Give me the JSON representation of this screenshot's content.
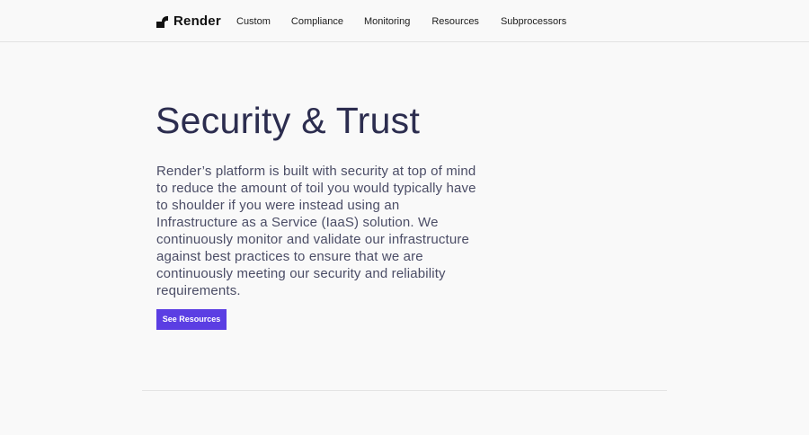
{
  "header": {
    "logo_text": "Render",
    "nav": [
      {
        "label": "Custom"
      },
      {
        "label": "Compliance"
      },
      {
        "label": "Monitoring"
      },
      {
        "label": "Resources"
      },
      {
        "label": "Subprocessors"
      }
    ]
  },
  "main": {
    "title": "Security & Trust",
    "description": "Render’s platform is built with security at top of mind to reduce the amount of toil you would typically have to shoulder if you were instead using an Infrastructure as a Service (IaaS) solution. We continuously monitor and validate our infrastructure against best practices to ensure that we are continuously meeting our security and reliability requirements.",
    "cta_label": "See Resources"
  },
  "colors": {
    "accent": "#5b3ee3",
    "title": "#2c2d4f",
    "body_text": "#4b4d66",
    "background": "#f9f9f9"
  }
}
